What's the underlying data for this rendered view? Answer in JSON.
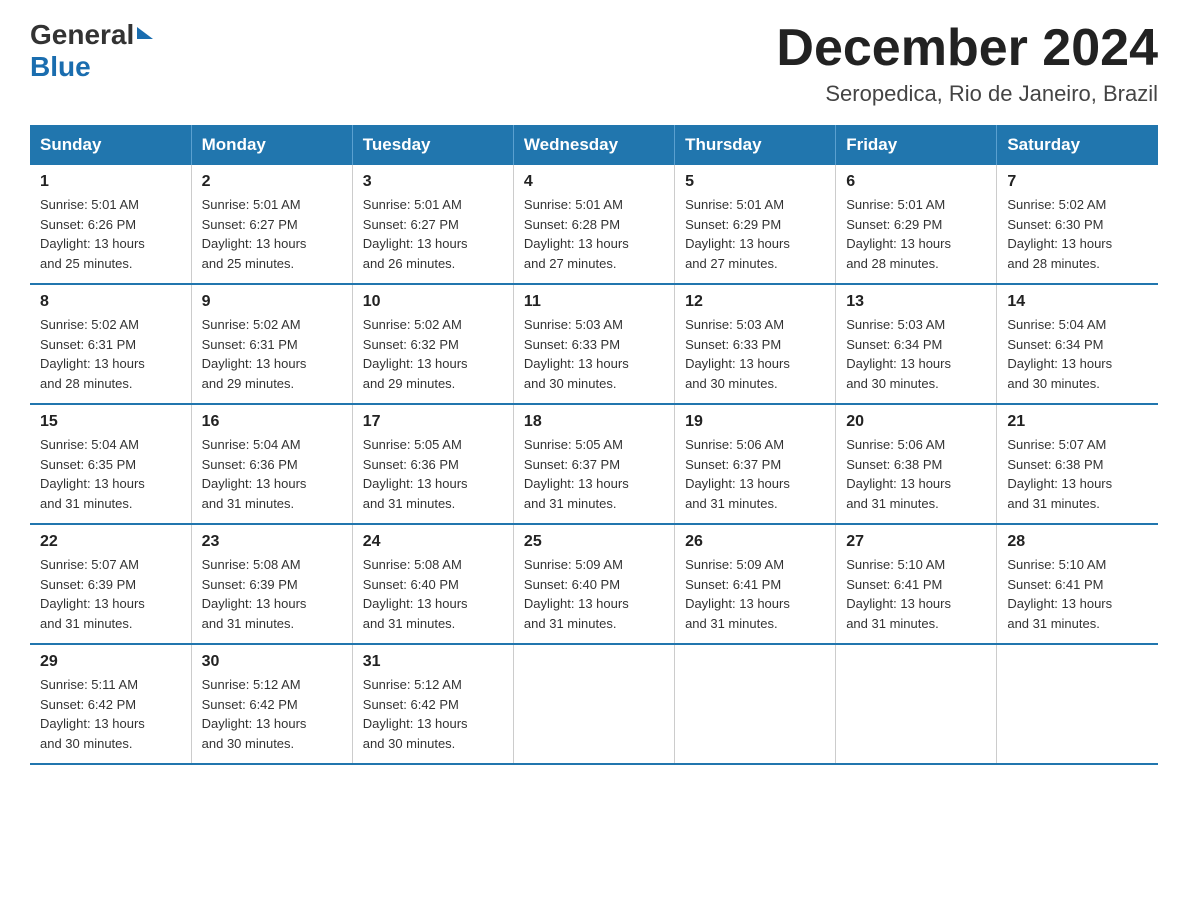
{
  "logo": {
    "general": "General",
    "triangle": "▲",
    "blue": "Blue"
  },
  "header": {
    "month": "December 2024",
    "location": "Seropedica, Rio de Janeiro, Brazil"
  },
  "days_of_week": [
    "Sunday",
    "Monday",
    "Tuesday",
    "Wednesday",
    "Thursday",
    "Friday",
    "Saturday"
  ],
  "weeks": [
    [
      {
        "day": "1",
        "sunrise": "5:01 AM",
        "sunset": "6:26 PM",
        "daylight": "13 hours and 25 minutes."
      },
      {
        "day": "2",
        "sunrise": "5:01 AM",
        "sunset": "6:27 PM",
        "daylight": "13 hours and 25 minutes."
      },
      {
        "day": "3",
        "sunrise": "5:01 AM",
        "sunset": "6:27 PM",
        "daylight": "13 hours and 26 minutes."
      },
      {
        "day": "4",
        "sunrise": "5:01 AM",
        "sunset": "6:28 PM",
        "daylight": "13 hours and 27 minutes."
      },
      {
        "day": "5",
        "sunrise": "5:01 AM",
        "sunset": "6:29 PM",
        "daylight": "13 hours and 27 minutes."
      },
      {
        "day": "6",
        "sunrise": "5:01 AM",
        "sunset": "6:29 PM",
        "daylight": "13 hours and 28 minutes."
      },
      {
        "day": "7",
        "sunrise": "5:02 AM",
        "sunset": "6:30 PM",
        "daylight": "13 hours and 28 minutes."
      }
    ],
    [
      {
        "day": "8",
        "sunrise": "5:02 AM",
        "sunset": "6:31 PM",
        "daylight": "13 hours and 28 minutes."
      },
      {
        "day": "9",
        "sunrise": "5:02 AM",
        "sunset": "6:31 PM",
        "daylight": "13 hours and 29 minutes."
      },
      {
        "day": "10",
        "sunrise": "5:02 AM",
        "sunset": "6:32 PM",
        "daylight": "13 hours and 29 minutes."
      },
      {
        "day": "11",
        "sunrise": "5:03 AM",
        "sunset": "6:33 PM",
        "daylight": "13 hours and 30 minutes."
      },
      {
        "day": "12",
        "sunrise": "5:03 AM",
        "sunset": "6:33 PM",
        "daylight": "13 hours and 30 minutes."
      },
      {
        "day": "13",
        "sunrise": "5:03 AM",
        "sunset": "6:34 PM",
        "daylight": "13 hours and 30 minutes."
      },
      {
        "day": "14",
        "sunrise": "5:04 AM",
        "sunset": "6:34 PM",
        "daylight": "13 hours and 30 minutes."
      }
    ],
    [
      {
        "day": "15",
        "sunrise": "5:04 AM",
        "sunset": "6:35 PM",
        "daylight": "13 hours and 31 minutes."
      },
      {
        "day": "16",
        "sunrise": "5:04 AM",
        "sunset": "6:36 PM",
        "daylight": "13 hours and 31 minutes."
      },
      {
        "day": "17",
        "sunrise": "5:05 AM",
        "sunset": "6:36 PM",
        "daylight": "13 hours and 31 minutes."
      },
      {
        "day": "18",
        "sunrise": "5:05 AM",
        "sunset": "6:37 PM",
        "daylight": "13 hours and 31 minutes."
      },
      {
        "day": "19",
        "sunrise": "5:06 AM",
        "sunset": "6:37 PM",
        "daylight": "13 hours and 31 minutes."
      },
      {
        "day": "20",
        "sunrise": "5:06 AM",
        "sunset": "6:38 PM",
        "daylight": "13 hours and 31 minutes."
      },
      {
        "day": "21",
        "sunrise": "5:07 AM",
        "sunset": "6:38 PM",
        "daylight": "13 hours and 31 minutes."
      }
    ],
    [
      {
        "day": "22",
        "sunrise": "5:07 AM",
        "sunset": "6:39 PM",
        "daylight": "13 hours and 31 minutes."
      },
      {
        "day": "23",
        "sunrise": "5:08 AM",
        "sunset": "6:39 PM",
        "daylight": "13 hours and 31 minutes."
      },
      {
        "day": "24",
        "sunrise": "5:08 AM",
        "sunset": "6:40 PM",
        "daylight": "13 hours and 31 minutes."
      },
      {
        "day": "25",
        "sunrise": "5:09 AM",
        "sunset": "6:40 PM",
        "daylight": "13 hours and 31 minutes."
      },
      {
        "day": "26",
        "sunrise": "5:09 AM",
        "sunset": "6:41 PM",
        "daylight": "13 hours and 31 minutes."
      },
      {
        "day": "27",
        "sunrise": "5:10 AM",
        "sunset": "6:41 PM",
        "daylight": "13 hours and 31 minutes."
      },
      {
        "day": "28",
        "sunrise": "5:10 AM",
        "sunset": "6:41 PM",
        "daylight": "13 hours and 31 minutes."
      }
    ],
    [
      {
        "day": "29",
        "sunrise": "5:11 AM",
        "sunset": "6:42 PM",
        "daylight": "13 hours and 30 minutes."
      },
      {
        "day": "30",
        "sunrise": "5:12 AM",
        "sunset": "6:42 PM",
        "daylight": "13 hours and 30 minutes."
      },
      {
        "day": "31",
        "sunrise": "5:12 AM",
        "sunset": "6:42 PM",
        "daylight": "13 hours and 30 minutes."
      },
      null,
      null,
      null,
      null
    ]
  ],
  "labels": {
    "sunrise": "Sunrise:",
    "sunset": "Sunset:",
    "daylight": "Daylight:"
  }
}
